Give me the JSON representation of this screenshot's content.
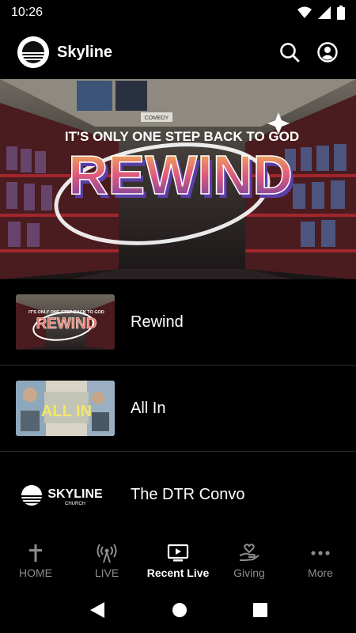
{
  "status_bar": {
    "time": "10:26",
    "icons": [
      "wifi-icon",
      "signal-icon",
      "battery-icon"
    ]
  },
  "app_bar": {
    "title": "Skyline",
    "actions": [
      "search-icon",
      "account-icon"
    ]
  },
  "hero": {
    "tagline": "IT'S ONLY ONE STEP BACK TO GOD",
    "title": "REWIND",
    "sign_label": "COMEDY"
  },
  "list": {
    "items": [
      {
        "title": "Rewind",
        "thumb_tagline": "IT'S ONLY ONE STEP BACK TO GOD",
        "thumb_title": "REWIND"
      },
      {
        "title": "All In",
        "thumb_title": "ALL IN"
      },
      {
        "title": "The DTR Convo",
        "thumb_brand": "SKYLINE",
        "thumb_brand_sub": "CHURCH"
      }
    ]
  },
  "bottom_nav": {
    "items": [
      {
        "label": "HOME",
        "icon": "cross-icon"
      },
      {
        "label": "LIVE",
        "icon": "broadcast-icon"
      },
      {
        "label": "Recent Live",
        "icon": "tv-play-icon"
      },
      {
        "label": "Giving",
        "icon": "hand-heart-icon"
      },
      {
        "label": "More",
        "icon": "more-dots-icon"
      }
    ],
    "active_index": 2
  },
  "system_nav": {
    "buttons": [
      "back-icon",
      "home-icon",
      "recents-icon"
    ]
  },
  "colors": {
    "background": "#000000",
    "text": "#ffffff",
    "inactive": "#8c8c8c",
    "divider": "#2a2a2a"
  }
}
